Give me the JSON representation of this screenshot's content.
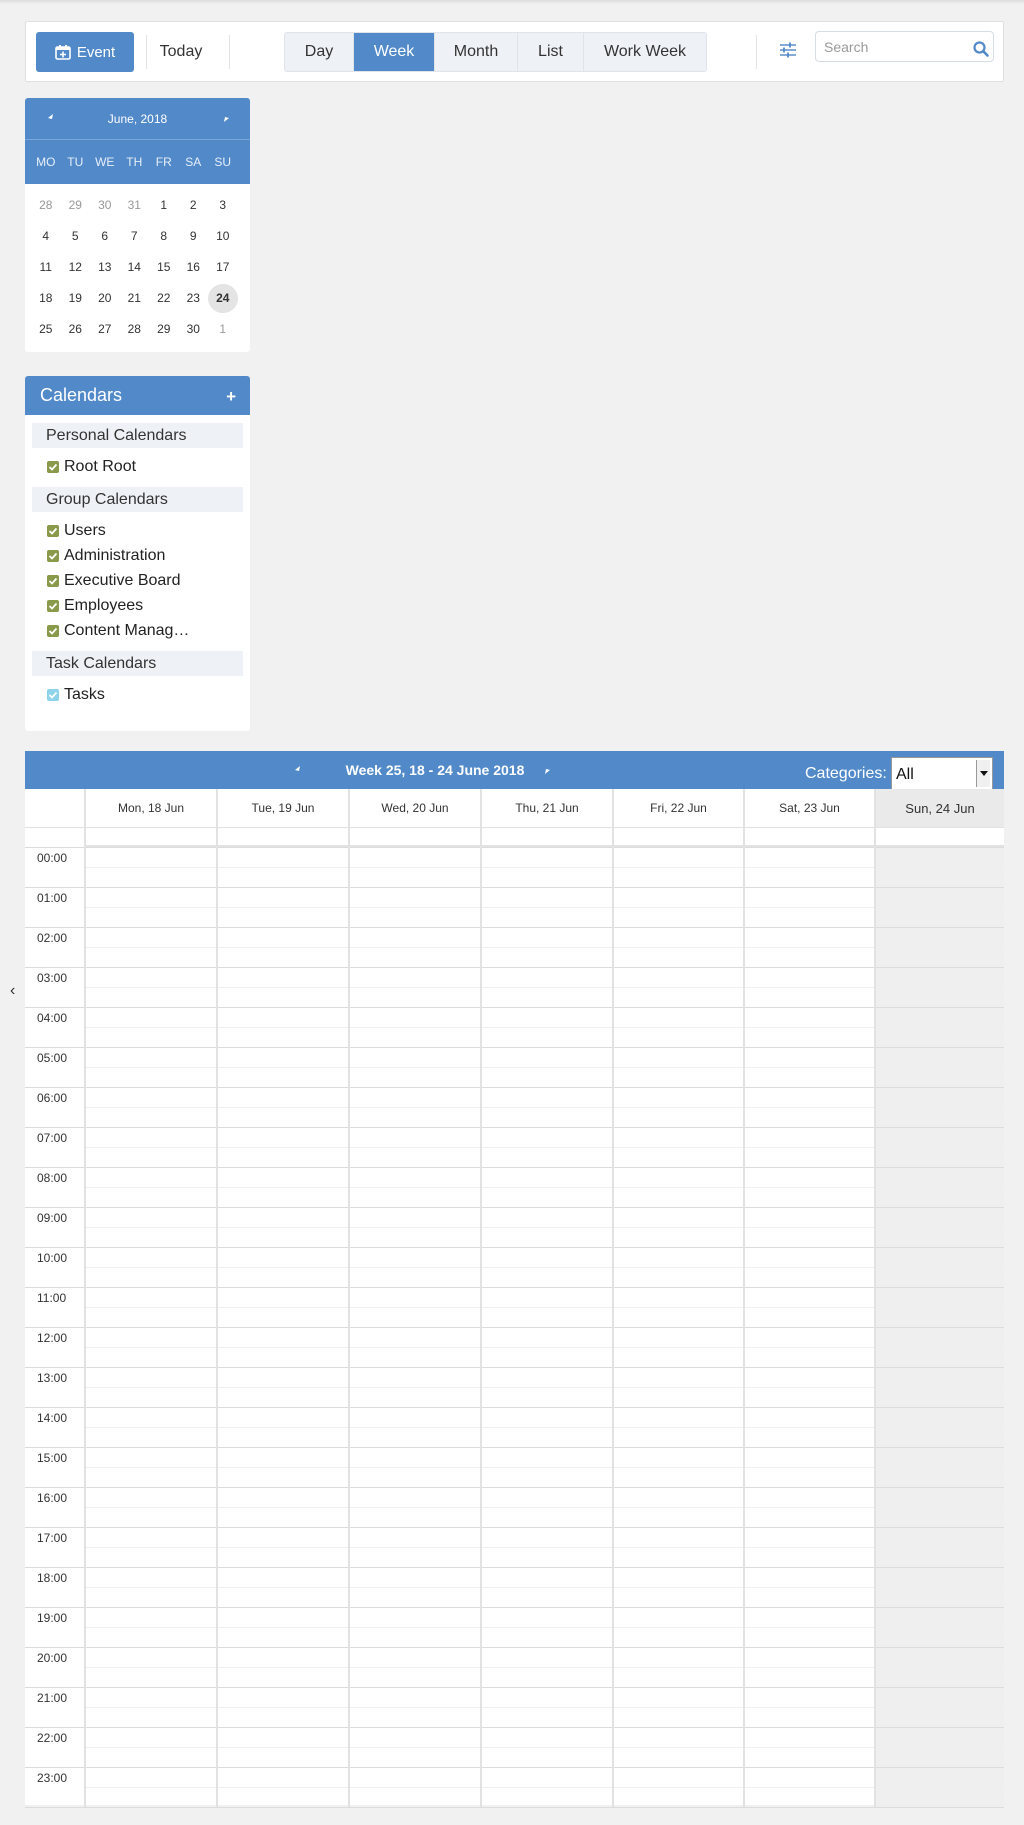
{
  "toolbar": {
    "event_label": "Event",
    "today_label": "Today",
    "views": [
      "Day",
      "Week",
      "Month",
      "List",
      "Work Week"
    ],
    "active_view": "Week",
    "search_placeholder": "Search"
  },
  "mini_calendar": {
    "title": "June, 2018",
    "weekdays": [
      "MO",
      "TU",
      "WE",
      "TH",
      "FR",
      "SA",
      "SU"
    ],
    "weeks": [
      [
        "28",
        "29",
        "30",
        "31",
        "1",
        "2",
        "3"
      ],
      [
        "4",
        "5",
        "6",
        "7",
        "8",
        "9",
        "10"
      ],
      [
        "11",
        "12",
        "13",
        "14",
        "15",
        "16",
        "17"
      ],
      [
        "18",
        "19",
        "20",
        "21",
        "22",
        "23",
        "24"
      ],
      [
        "25",
        "26",
        "27",
        "28",
        "29",
        "30",
        "1"
      ]
    ],
    "today": "24"
  },
  "calendars": {
    "title": "Calendars",
    "sections": [
      {
        "label": "Personal Calendars",
        "items": [
          "Root Root"
        ]
      },
      {
        "label": "Group Calendars",
        "items": [
          "Users",
          "Administration",
          "Executive Board",
          "Employees",
          "Content Manag…"
        ]
      },
      {
        "label": "Task Calendars",
        "items": [
          "Tasks"
        ]
      }
    ]
  },
  "week_view": {
    "title": "Week 25, 18 - 24 June 2018",
    "categories_label": "Categories:",
    "categories_value": "All",
    "days": [
      "Mon, 18 Jun",
      "Tue, 19 Jun",
      "Wed, 20 Jun",
      "Thu, 21 Jun",
      "Fri, 22 Jun",
      "Sat, 23 Jun",
      "Sun, 24 Jun"
    ],
    "hours": [
      "00:00",
      "01:00",
      "02:00",
      "03:00",
      "04:00",
      "05:00",
      "06:00",
      "07:00",
      "08:00",
      "09:00",
      "10:00",
      "11:00",
      "12:00",
      "13:00",
      "14:00",
      "15:00",
      "16:00",
      "17:00",
      "18:00",
      "19:00",
      "20:00",
      "21:00",
      "22:00",
      "23:00"
    ]
  },
  "colors": {
    "accent": "#5189c9",
    "check_green": "#8a9a4b",
    "check_light": "#8fd3ea"
  }
}
